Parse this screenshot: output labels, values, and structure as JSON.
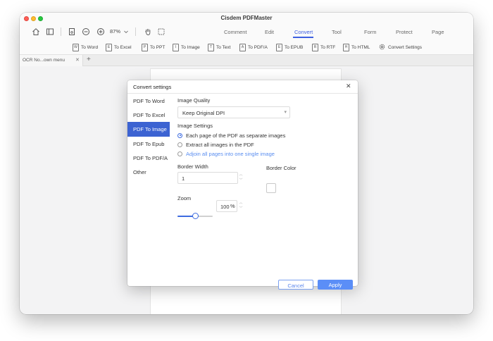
{
  "app": {
    "title": "Cisdem PDFMaster"
  },
  "toolbar": {
    "zoom": "87%"
  },
  "menu": {
    "tabs": [
      {
        "label": "Comment",
        "active": false
      },
      {
        "label": "Edit",
        "active": false
      },
      {
        "label": "Convert",
        "active": true
      },
      {
        "label": "Tool",
        "active": false
      },
      {
        "label": "Form",
        "active": false
      },
      {
        "label": "Protect",
        "active": false
      },
      {
        "label": "Page",
        "active": false
      }
    ]
  },
  "convert_tools": [
    {
      "label": "To Word",
      "icon": "W"
    },
    {
      "label": "To Excel",
      "icon": "E"
    },
    {
      "label": "To PPT",
      "icon": "P"
    },
    {
      "label": "To Image",
      "icon": "I"
    },
    {
      "label": "To Text",
      "icon": "T"
    },
    {
      "label": "To PDF/A",
      "icon": "A"
    },
    {
      "label": "To EPUB",
      "icon": "E"
    },
    {
      "label": "To RTF",
      "icon": "R"
    },
    {
      "label": "To HTML",
      "icon": "H"
    },
    {
      "label": "Convert Settings",
      "icon": "gear-icon"
    }
  ],
  "document_tab": {
    "name": "OCR No...own menu"
  },
  "dialog": {
    "title": "Convert settings",
    "sidebar": [
      {
        "label": "PDF To Word",
        "active": false
      },
      {
        "label": "PDF To Excel",
        "active": false
      },
      {
        "label": "PDF To Image",
        "active": true
      },
      {
        "label": "PDF To Epub",
        "active": false
      },
      {
        "label": "PDF To PDF/A",
        "active": false
      },
      {
        "label": "Other",
        "active": false
      }
    ],
    "image_quality": {
      "label": "Image Quality",
      "value": "Keep Original DPI"
    },
    "image_settings": {
      "label": "Image Settings",
      "options": [
        {
          "label": "Each page of the PDF as separate images",
          "selected": true
        },
        {
          "label": "Extract all images in the PDF",
          "selected": false
        },
        {
          "label": "Adjoin all pages into one single image",
          "selected": false
        }
      ]
    },
    "border_width": {
      "label": "Border Width",
      "value": "1"
    },
    "border_color": {
      "label": "Border Color",
      "value": "#ffffff"
    },
    "zoom": {
      "label": "Zoom",
      "value": "100",
      "unit": "%",
      "slider_level": 0.5
    },
    "buttons": {
      "cancel": "Cancel",
      "apply": "Apply"
    }
  },
  "colors": {
    "accent": "#3d5fe0",
    "sidebar_active": "#3c63d2",
    "apply_button": "#5b8ef7"
  }
}
